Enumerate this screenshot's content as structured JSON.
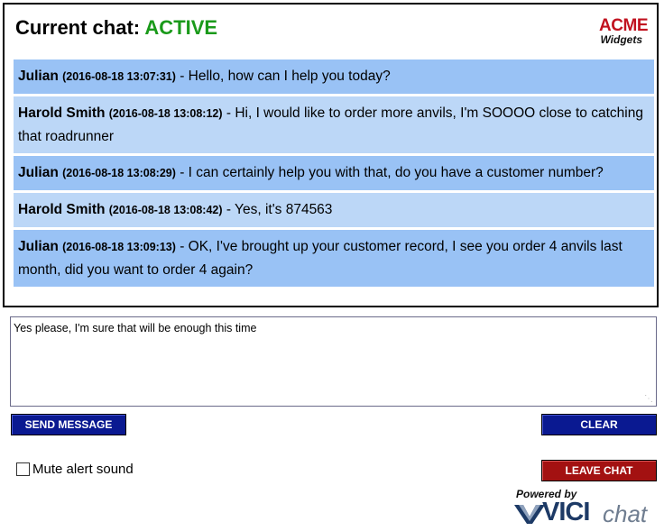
{
  "header": {
    "title_label": "Current chat:",
    "status": "ACTIVE",
    "status_color": "#1a9a1a"
  },
  "brand": {
    "logo_word": "ACME",
    "logo_sub": "Widgets"
  },
  "messages": [
    {
      "sender": "Julian",
      "timestamp": "(2016-08-18 13:07:31)",
      "text": " - Hello, how can I help you today?",
      "role": "agent"
    },
    {
      "sender": "Harold Smith",
      "timestamp": "(2016-08-18 13:08:12)",
      "text": " - Hi, I would like to order more anvils, I'm SOOOO close to catching that roadrunner",
      "role": "customer"
    },
    {
      "sender": "Julian",
      "timestamp": "(2016-08-18 13:08:29)",
      "text": " - I can certainly help you with that, do you have a customer number?",
      "role": "agent"
    },
    {
      "sender": "Harold Smith",
      "timestamp": "(2016-08-18 13:08:42)",
      "text": " - Yes, it's 874563",
      "role": "customer"
    },
    {
      "sender": "Julian",
      "timestamp": "(2016-08-18 13:09:13)",
      "text": " - OK, I've brought up your customer record, I see you order 4 anvils last month, did you want to order 4 again?",
      "role": "agent"
    }
  ],
  "colors": {
    "agent_row": "#99c2f5",
    "customer_row": "#bcd7f7",
    "primary_button": "#0a1991",
    "danger_button": "#a31111"
  },
  "reply": {
    "value": "Yes please, I'm sure that will be enough this time"
  },
  "buttons": {
    "send": "SEND MESSAGE",
    "clear": "CLEAR",
    "leave": "LEAVE CHAT"
  },
  "mute": {
    "label": "Mute alert sound",
    "checked": false
  },
  "footer": {
    "powered_by": "Powered by",
    "brand_vici": "VICI",
    "brand_chat": "chat"
  },
  "icons": {
    "grip": "resize-grip-icon",
    "vici_mark": "vici-v-mark-icon"
  }
}
